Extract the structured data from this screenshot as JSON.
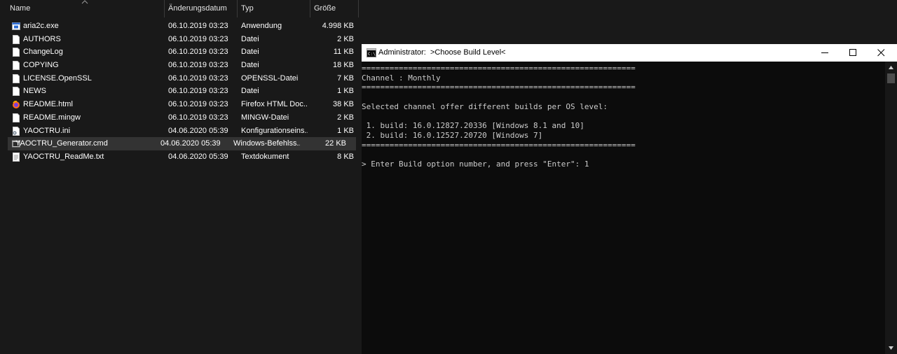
{
  "explorer": {
    "columns": {
      "name": "Name",
      "date": "Änderungsdatum",
      "type": "Typ",
      "size": "Größe"
    },
    "sort": "Name ascending",
    "files": [
      {
        "name": "aria2c.exe",
        "date": "06.10.2019 03:23",
        "type": "Anwendung",
        "size": "4.998 KB",
        "icon": "exe-icon"
      },
      {
        "name": "AUTHORS",
        "date": "06.10.2019 03:23",
        "type": "Datei",
        "size": "2 KB",
        "icon": "file-icon"
      },
      {
        "name": "ChangeLog",
        "date": "06.10.2019 03:23",
        "type": "Datei",
        "size": "11 KB",
        "icon": "file-icon"
      },
      {
        "name": "COPYING",
        "date": "06.10.2019 03:23",
        "type": "Datei",
        "size": "18 KB",
        "icon": "file-icon"
      },
      {
        "name": "LICENSE.OpenSSL",
        "date": "06.10.2019 03:23",
        "type": "OPENSSL-Datei",
        "size": "7 KB",
        "icon": "file-icon"
      },
      {
        "name": "NEWS",
        "date": "06.10.2019 03:23",
        "type": "Datei",
        "size": "1 KB",
        "icon": "file-icon"
      },
      {
        "name": "README.html",
        "date": "06.10.2019 03:23",
        "type": "Firefox HTML Doc...",
        "size": "38 KB",
        "icon": "firefox-html-icon"
      },
      {
        "name": "README.mingw",
        "date": "06.10.2019 03:23",
        "type": "MINGW-Datei",
        "size": "2 KB",
        "icon": "file-icon"
      },
      {
        "name": "YAOCTRU.ini",
        "date": "04.06.2020 05:39",
        "type": "Konfigurationseins...",
        "size": "1 KB",
        "icon": "config-file-icon"
      },
      {
        "name": "YAOCTRU_Generator.cmd",
        "date": "04.06.2020 05:39",
        "type": "Windows-Befehlss...",
        "size": "22 KB",
        "icon": "cmd-file-icon",
        "selected": true
      },
      {
        "name": "YAOCTRU_ReadMe.txt",
        "date": "04.06.2020 05:39",
        "type": "Textdokument",
        "size": "8 KB",
        "icon": "text-file-icon"
      }
    ]
  },
  "cmd": {
    "title": "Administrator:  >Choose Build Level<",
    "lines": [
      "===========================================================",
      "Channel : Monthly",
      "===========================================================",
      "",
      "Selected channel offer different builds per OS level:",
      "",
      " 1. build: 16.0.12827.20336 [Windows 8.1 and 10]",
      " 2. build: 16.0.12527.20720 [Windows 7]",
      "===========================================================",
      "",
      "> Enter Build option number, and press \"Enter\": 1"
    ]
  },
  "colors": {
    "explorer_bg": "#191919",
    "console_bg": "#0c0c0c",
    "console_text": "#cccccc",
    "selected_row": "#333333",
    "titlebar": "#ffffff"
  }
}
